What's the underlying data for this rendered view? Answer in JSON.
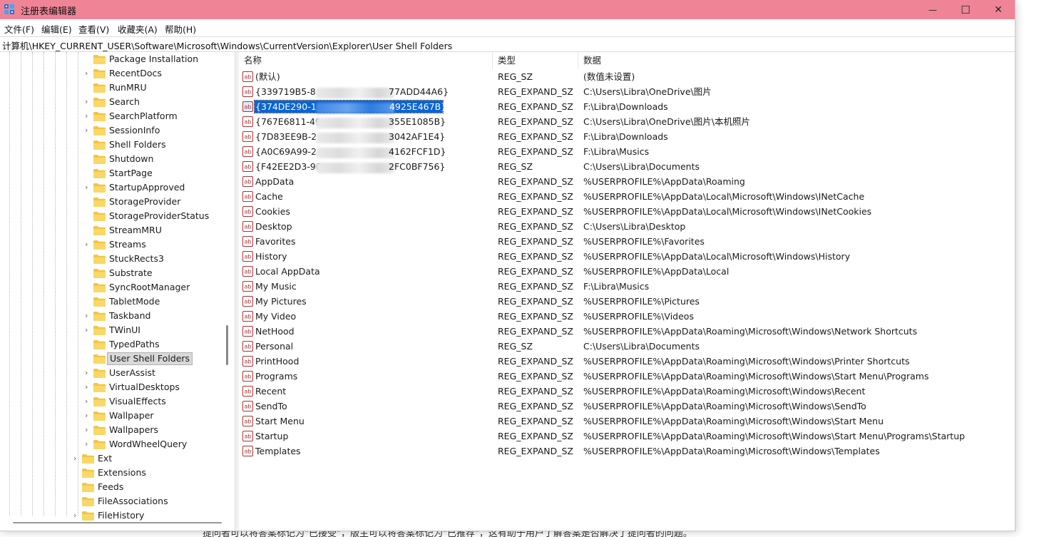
{
  "background_text": "提问者可以将答案标记为\"已接受\"，版主可以将答案标记为\"已推荐\"，这有助于用户了解答案是否解决了提问者的问题。",
  "window": {
    "title": "注册表编辑器",
    "minimize_glyph": "—",
    "maximize_glyph": "☐",
    "close_glyph": "✕"
  },
  "menu": [
    {
      "label": "文件(F)"
    },
    {
      "label": "编辑(E)"
    },
    {
      "label": "查看(V)"
    },
    {
      "label": "收藏夹(A)"
    },
    {
      "label": "帮助(H)"
    }
  ],
  "address": "计算机\\HKEY_CURRENT_USER\\Software\\Microsoft\\Windows\\CurrentVersion\\Explorer\\User Shell Folders",
  "tree": {
    "items": [
      {
        "label": "Package Installation",
        "expandable": false,
        "level": 2
      },
      {
        "label": "RecentDocs",
        "expandable": true,
        "level": 2
      },
      {
        "label": "RunMRU",
        "expandable": false,
        "level": 2
      },
      {
        "label": "Search",
        "expandable": true,
        "level": 2
      },
      {
        "label": "SearchPlatform",
        "expandable": true,
        "level": 2
      },
      {
        "label": "SessionInfo",
        "expandable": true,
        "level": 2
      },
      {
        "label": "Shell Folders",
        "expandable": false,
        "level": 2
      },
      {
        "label": "Shutdown",
        "expandable": false,
        "level": 2
      },
      {
        "label": "StartPage",
        "expandable": false,
        "level": 2
      },
      {
        "label": "StartupApproved",
        "expandable": true,
        "level": 2
      },
      {
        "label": "StorageProvider",
        "expandable": false,
        "level": 2
      },
      {
        "label": "StorageProviderStatus",
        "expandable": false,
        "level": 2
      },
      {
        "label": "StreamMRU",
        "expandable": false,
        "level": 2
      },
      {
        "label": "Streams",
        "expandable": true,
        "level": 2
      },
      {
        "label": "StuckRects3",
        "expandable": false,
        "level": 2
      },
      {
        "label": "Substrate",
        "expandable": false,
        "level": 2
      },
      {
        "label": "SyncRootManager",
        "expandable": false,
        "level": 2
      },
      {
        "label": "TabletMode",
        "expandable": false,
        "level": 2
      },
      {
        "label": "Taskband",
        "expandable": true,
        "level": 2
      },
      {
        "label": "TWinUI",
        "expandable": true,
        "level": 2
      },
      {
        "label": "TypedPaths",
        "expandable": false,
        "level": 2
      },
      {
        "label": "User Shell Folders",
        "expandable": false,
        "level": 2,
        "selected": true
      },
      {
        "label": "UserAssist",
        "expandable": true,
        "level": 2
      },
      {
        "label": "VirtualDesktops",
        "expandable": true,
        "level": 2
      },
      {
        "label": "VisualEffects",
        "expandable": true,
        "level": 2
      },
      {
        "label": "Wallpaper",
        "expandable": true,
        "level": 2
      },
      {
        "label": "Wallpapers",
        "expandable": true,
        "level": 2
      },
      {
        "label": "WordWheelQuery",
        "expandable": true,
        "level": 2
      },
      {
        "label": "Ext",
        "expandable": true,
        "level": 1
      },
      {
        "label": "Extensions",
        "expandable": false,
        "level": 1
      },
      {
        "label": "Feeds",
        "expandable": false,
        "level": 1
      },
      {
        "label": "FileAssociations",
        "expandable": false,
        "level": 1
      },
      {
        "label": "FileHistory",
        "expandable": true,
        "level": 1
      }
    ]
  },
  "list": {
    "headers": {
      "name": "名称",
      "type": "类型",
      "data": "数据"
    },
    "rows": [
      {
        "name": "(默认)",
        "type": "REG_SZ",
        "data": "(数值未设置)"
      },
      {
        "name": "{339719B5-8",
        "name_end": "77ADD44A6}",
        "blurred": true,
        "type": "REG_EXPAND_SZ",
        "data": "C:\\Users\\Libra\\OneDrive\\图片"
      },
      {
        "name": "{374DE290-1",
        "name_end": "4925E467B}",
        "blurred": true,
        "selected": true,
        "type": "REG_EXPAND_SZ",
        "data": "F:\\Libra\\Downloads"
      },
      {
        "name": "{767E6811-49",
        "name_end": "355E1085B}",
        "blurred": true,
        "type": "REG_EXPAND_SZ",
        "data": "C:\\Users\\Libra\\OneDrive\\图片\\本机照片"
      },
      {
        "name": "{7D83EE9B-2",
        "name_end": "3042AF1E4}",
        "blurred": true,
        "type": "REG_EXPAND_SZ",
        "data": "F:\\Libra\\Downloads"
      },
      {
        "name": "{A0C69A99-2",
        "name_end": "4162FCF1D}",
        "blurred": true,
        "type": "REG_EXPAND_SZ",
        "data": "F:\\Libra\\Musics"
      },
      {
        "name": "{F42EE2D3-90",
        "name_end": "2FC0BF756}",
        "blurred": true,
        "type": "REG_SZ",
        "data": "C:\\Users\\Libra\\Documents"
      },
      {
        "name": "AppData",
        "type": "REG_EXPAND_SZ",
        "data": "%USERPROFILE%\\AppData\\Roaming"
      },
      {
        "name": "Cache",
        "type": "REG_EXPAND_SZ",
        "data": "%USERPROFILE%\\AppData\\Local\\Microsoft\\Windows\\INetCache"
      },
      {
        "name": "Cookies",
        "type": "REG_EXPAND_SZ",
        "data": "%USERPROFILE%\\AppData\\Local\\Microsoft\\Windows\\INetCookies"
      },
      {
        "name": "Desktop",
        "type": "REG_EXPAND_SZ",
        "data": "C:\\Users\\Libra\\Desktop"
      },
      {
        "name": "Favorites",
        "type": "REG_EXPAND_SZ",
        "data": "%USERPROFILE%\\Favorites"
      },
      {
        "name": "History",
        "type": "REG_EXPAND_SZ",
        "data": "%USERPROFILE%\\AppData\\Local\\Microsoft\\Windows\\History"
      },
      {
        "name": "Local AppData",
        "type": "REG_EXPAND_SZ",
        "data": "%USERPROFILE%\\AppData\\Local"
      },
      {
        "name": "My Music",
        "type": "REG_EXPAND_SZ",
        "data": "F:\\Libra\\Musics"
      },
      {
        "name": "My Pictures",
        "type": "REG_EXPAND_SZ",
        "data": "%USERPROFILE%\\Pictures"
      },
      {
        "name": "My Video",
        "type": "REG_EXPAND_SZ",
        "data": "%USERPROFILE%\\Videos"
      },
      {
        "name": "NetHood",
        "type": "REG_EXPAND_SZ",
        "data": "%USERPROFILE%\\AppData\\Roaming\\Microsoft\\Windows\\Network Shortcuts"
      },
      {
        "name": "Personal",
        "type": "REG_SZ",
        "data": "C:\\Users\\Libra\\Documents"
      },
      {
        "name": "PrintHood",
        "type": "REG_EXPAND_SZ",
        "data": "%USERPROFILE%\\AppData\\Roaming\\Microsoft\\Windows\\Printer Shortcuts"
      },
      {
        "name": "Programs",
        "type": "REG_EXPAND_SZ",
        "data": "%USERPROFILE%\\AppData\\Roaming\\Microsoft\\Windows\\Start Menu\\Programs"
      },
      {
        "name": "Recent",
        "type": "REG_EXPAND_SZ",
        "data": "%USERPROFILE%\\AppData\\Roaming\\Microsoft\\Windows\\Recent"
      },
      {
        "name": "SendTo",
        "type": "REG_EXPAND_SZ",
        "data": "%USERPROFILE%\\AppData\\Roaming\\Microsoft\\Windows\\SendTo"
      },
      {
        "name": "Start Menu",
        "type": "REG_EXPAND_SZ",
        "data": "%USERPROFILE%\\AppData\\Roaming\\Microsoft\\Windows\\Start Menu"
      },
      {
        "name": "Startup",
        "type": "REG_EXPAND_SZ",
        "data": "%USERPROFILE%\\AppData\\Roaming\\Microsoft\\Windows\\Start Menu\\Programs\\Startup"
      },
      {
        "name": "Templates",
        "type": "REG_EXPAND_SZ",
        "data": "%USERPROFILE%\\AppData\\Roaming\\Microsoft\\Windows\\Templates"
      }
    ]
  },
  "icons": {
    "app": "registry-editor-icon",
    "folder": "folder-icon",
    "string_value": "string-value-icon",
    "expand": "chevron-right-icon"
  },
  "colors": {
    "titlebar": "#f08497",
    "selection": "#0a64d8",
    "folder": "#f4c542"
  }
}
